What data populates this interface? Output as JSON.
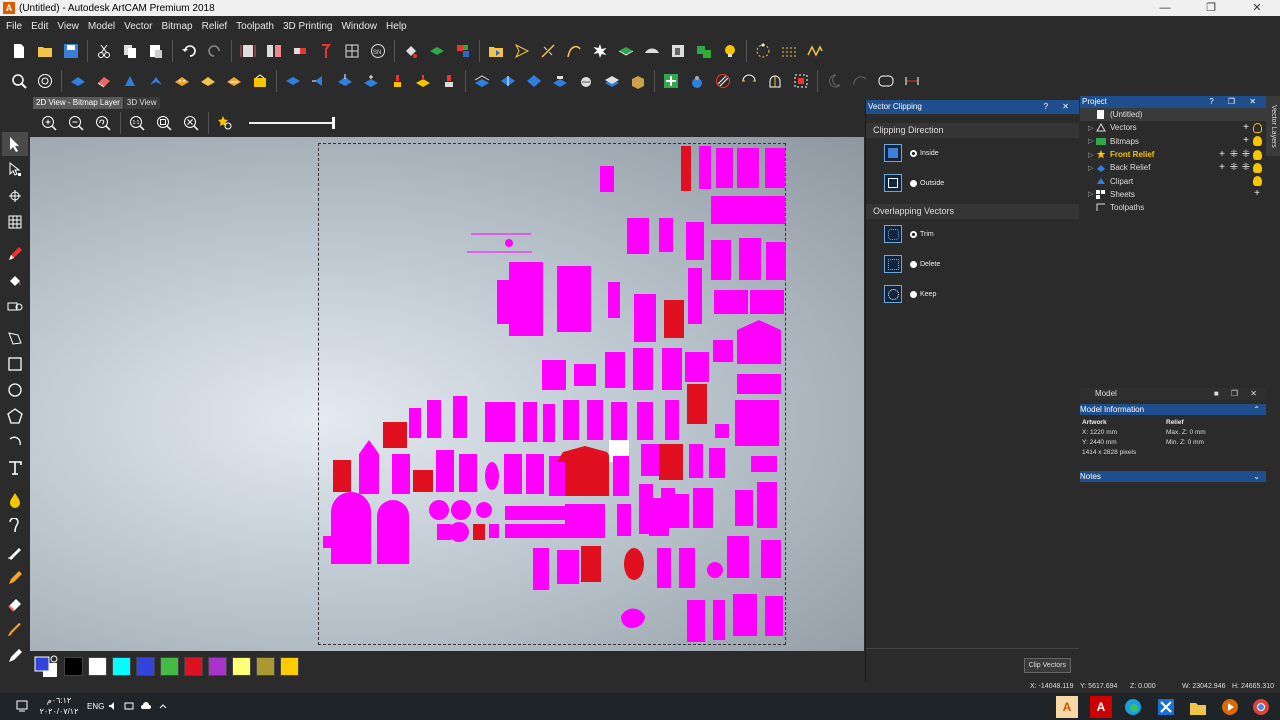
{
  "window": {
    "title": "(Untitled) - Autodesk ArtCAM Premium 2018",
    "app_icon_letter": "A",
    "minimize": "—",
    "maximize": "❐",
    "close": "✕"
  },
  "menu": [
    "File",
    "Edit",
    "View",
    "Model",
    "Vector",
    "Bitmap",
    "Relief",
    "Toolpath",
    "3D Printing",
    "Window",
    "Help"
  ],
  "view_tabs": [
    {
      "label": "2D View - Bitmap Layer",
      "active": true
    },
    {
      "label": "3D View",
      "active": false
    }
  ],
  "palette": {
    "current_foreground": "#3344dd",
    "current_background": "#ffffff",
    "colors": [
      "#000000",
      "#ffffff",
      "#00ffff",
      "#3344dd",
      "#44bb44",
      "#dd1122",
      "#aa33cc",
      "#ffff77",
      "#aa9933",
      "#ffcc00"
    ]
  },
  "vector_clipping": {
    "title": "Vector Clipping",
    "controls": "? ✕",
    "clipping_direction": {
      "title": "Clipping Direction",
      "options": [
        {
          "label": "Inside",
          "selected": true
        },
        {
          "label": "Outside",
          "selected": false
        }
      ]
    },
    "overlapping_vectors": {
      "title": "Overlapping Vectors",
      "options": [
        {
          "label": "Trim",
          "selected": true
        },
        {
          "label": "Delete",
          "selected": false
        },
        {
          "label": "Keep",
          "selected": false
        }
      ]
    },
    "clip_button": "Clip Vectors"
  },
  "project": {
    "title": "Project",
    "controls": "? ❐ ✕",
    "root": "(Untitled)",
    "items": [
      {
        "label": "Vectors",
        "expandable": true,
        "highlight": false
      },
      {
        "label": "Bitmaps",
        "expandable": true,
        "highlight": false
      },
      {
        "label": "Front Relief",
        "expandable": true,
        "highlight": true
      },
      {
        "label": "Back Relief",
        "expandable": true,
        "highlight": false
      },
      {
        "label": "Clipart",
        "expandable": false,
        "highlight": false
      },
      {
        "label": "Sheets",
        "expandable": true,
        "highlight": false
      },
      {
        "label": "Toolpaths",
        "expandable": false,
        "highlight": false
      }
    ],
    "side_tab": "Vector Layers"
  },
  "model": {
    "title": "Model",
    "controls": "■ ❐ ✕",
    "info_title": "Model Information",
    "artwork_header": "Artwork",
    "relief_header": "Relief",
    "artwork_x": "X: 1220 mm",
    "artwork_y": "Y: 2440 mm",
    "artwork_pixels": "1414 x 2828 pixels",
    "relief_max": "Max. Z: 0 mm",
    "relief_min": "Min. Z: 0 mm",
    "notes_title": "Notes"
  },
  "status": {
    "x": "X: -14048.119",
    "y": "Y: 5617.694",
    "z": "Z: 0.000",
    "w": "W: 23042.946",
    "h": "H: 24665.310"
  },
  "taskbar": {
    "time": "٠٦:١٢م",
    "date": "٢٠٢٠/٠٧/١٢",
    "lang": "ENG"
  }
}
